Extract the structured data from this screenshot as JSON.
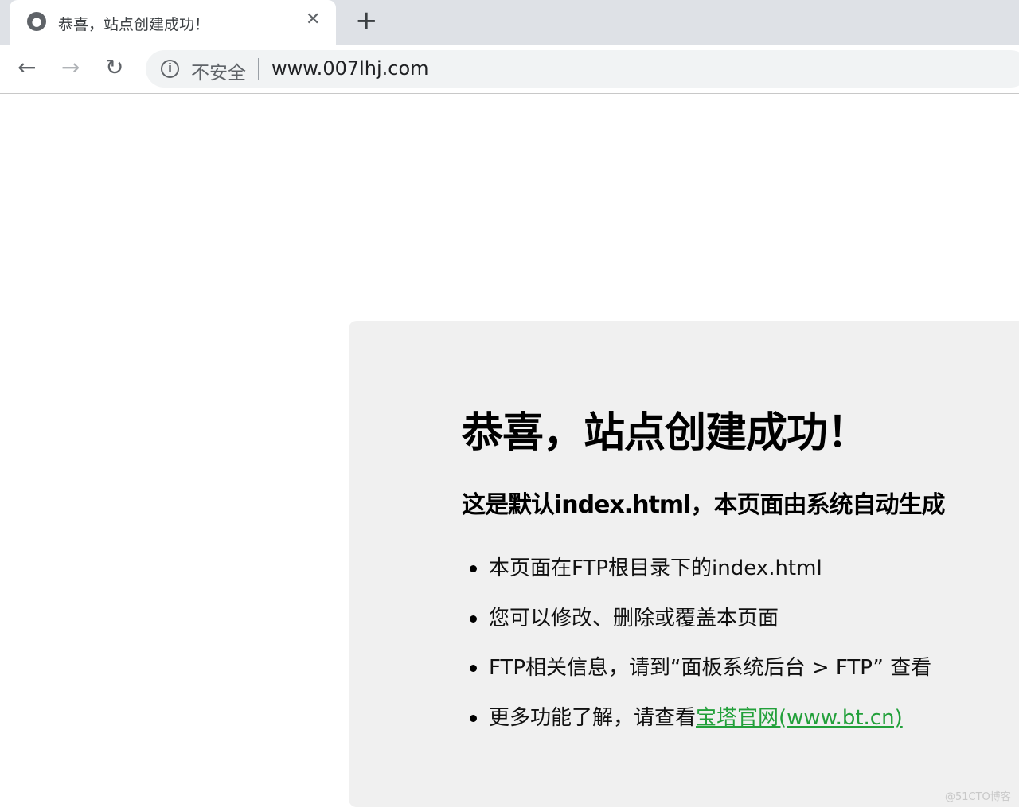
{
  "browser": {
    "tab_title": "恭喜，站点创建成功！",
    "security_label": "不安全",
    "url": "www.007lhj.com"
  },
  "page": {
    "title": "恭喜，站点创建成功！",
    "subtitle": "这是默认index.html，本页面由系统自动生成",
    "items": [
      "本页面在FTP根目录下的index.html",
      "您可以修改、删除或覆盖本页面",
      "FTP相关信息，请到“面板系统后台 > FTP” 查看"
    ],
    "more_prefix": "更多功能了解，请查看",
    "more_link": "宝塔官网(www.bt.cn)",
    "link_color": "#22a03a"
  },
  "watermark": "@51CTO博客"
}
